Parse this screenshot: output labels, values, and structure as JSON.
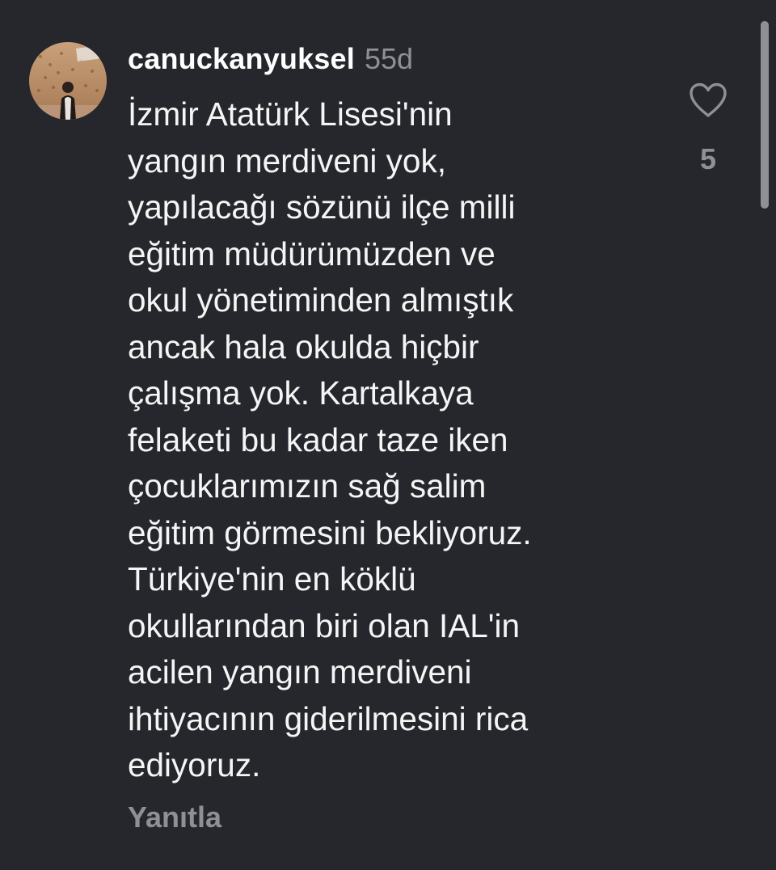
{
  "comment": {
    "username": "canuckanyuksel",
    "time_ago": "55d",
    "text": "İzmir Atatürk Lisesi'nin\nyangın merdiveni yok,\nyapılacağı sözünü ilçe milli\neğitim müdürümüzden ve\nokul yönetiminden almıştık\nancak hala okulda hiçbir\nçalışma yok. Kartalkaya\nfelaketi bu kadar taze iken\nçocuklarımızın sağ salim\neğitim görmesini bekliyoruz.\nTürkiye'nin en köklü\nokullarından biri olan IAL'in\nacilen yangın merdiveni\nihtiyacının giderilmesini rica\nediyoruz.",
    "reply_label": "Yanıtla",
    "like_count": "5",
    "like_icon": "heart-outline-icon"
  },
  "colors": {
    "background": "#25272c",
    "primary_text": "#f5f5f5",
    "secondary_text": "#8e9097",
    "scrollbar": "#8f9095"
  }
}
